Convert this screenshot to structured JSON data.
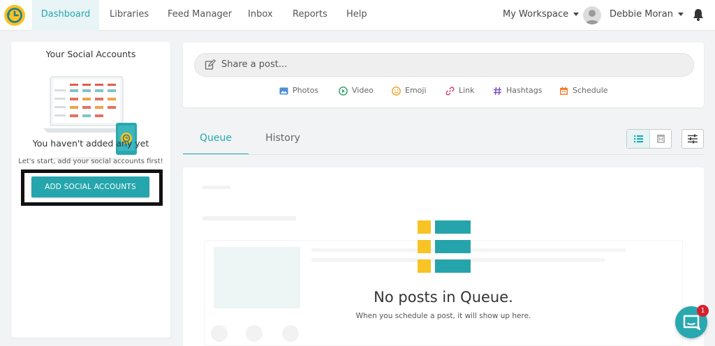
{
  "nav": {
    "items": [
      "Dashboard",
      "Libraries",
      "Feed Manager",
      "Inbox",
      "Reports",
      "Help"
    ],
    "active": "Dashboard",
    "workspace": "My Workspace",
    "user": "Debbie Moran"
  },
  "social_accounts": {
    "title": "Your Social Accounts",
    "empty_title": "You haven't added any yet",
    "empty_subtitle": "Let's start, add your social accounts first!",
    "add_button": "ADD SOCIAL ACCOUNTS"
  },
  "composer": {
    "placeholder": "Share a post...",
    "tools": [
      "Photos",
      "Video",
      "Emoji",
      "Link",
      "Hashtags",
      "Schedule"
    ]
  },
  "tabs": [
    "Queue",
    "History"
  ],
  "queue": {
    "empty_title": "No posts in Queue.",
    "empty_subtitle": "When you schedule a post, it will show up here."
  },
  "chat": {
    "badge_count": "1"
  },
  "colors": {
    "accent": "#23a9b1",
    "button": "#25a6ac",
    "logo_yellow": "#f7c325",
    "badge_red": "#d4212d"
  }
}
